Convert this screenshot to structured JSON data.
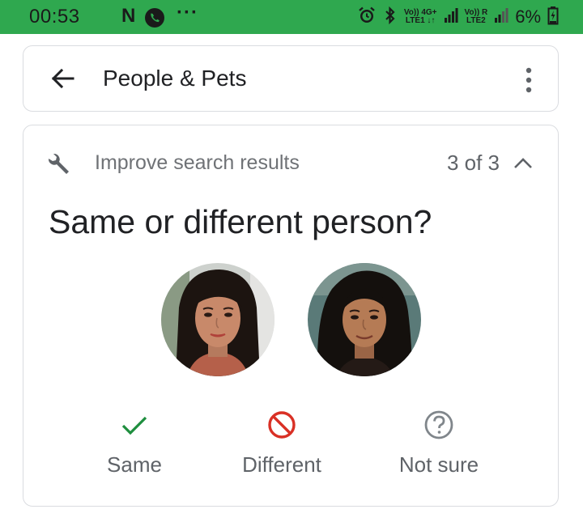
{
  "status_bar": {
    "time": "00:53",
    "notification_n": "N",
    "more_dots": "···",
    "net1_top": "Vo)) 4G+",
    "net1_bottom": "LTE1 ↓↑",
    "net2_top": "Vo)) R",
    "net2_bottom": "LTE2",
    "battery_percent": "6%",
    "color": "#2fa84f"
  },
  "header": {
    "title": "People & Pets"
  },
  "improve_card": {
    "heading": "Improve search results",
    "counter": "3 of 3",
    "question": "Same or different person?",
    "options": [
      {
        "label": "Same",
        "icon": "check-icon",
        "color": "#1e8e3e"
      },
      {
        "label": "Different",
        "icon": "block-icon",
        "color": "#d93025"
      },
      {
        "label": "Not sure",
        "icon": "help-icon",
        "color": "#80868b"
      }
    ]
  }
}
